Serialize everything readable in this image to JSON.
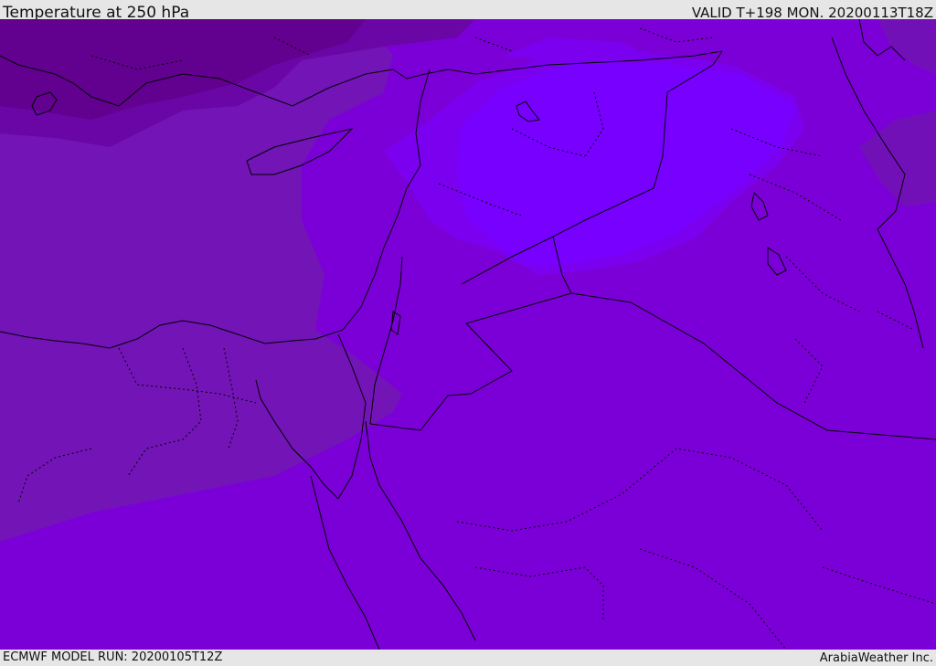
{
  "header": {
    "title": "Temperature at 250 hPa",
    "valid_time": "VALID T+198 MON. 20200113T18Z"
  },
  "footer": {
    "model_run": "ECMWF MODEL RUN: 20200105T12Z",
    "credit": "ArabiaWeather Inc."
  },
  "colors": {
    "frame_background": "#e6e6e6",
    "base_field": "#7b00d7",
    "western_band": "#7214b6",
    "northwest_cold": "#6a06a6",
    "northwest_darkest": "#620090",
    "northeast_warm_patch": "#7b00f0",
    "northeast_warmest_patch": "#7700ff",
    "east_edge_patch": "#7210b8",
    "coastline": "#000000",
    "borders": "#000000"
  },
  "map": {
    "field": "temperature",
    "level": "250 hPa",
    "region": "Eastern Mediterranean and Middle East"
  }
}
